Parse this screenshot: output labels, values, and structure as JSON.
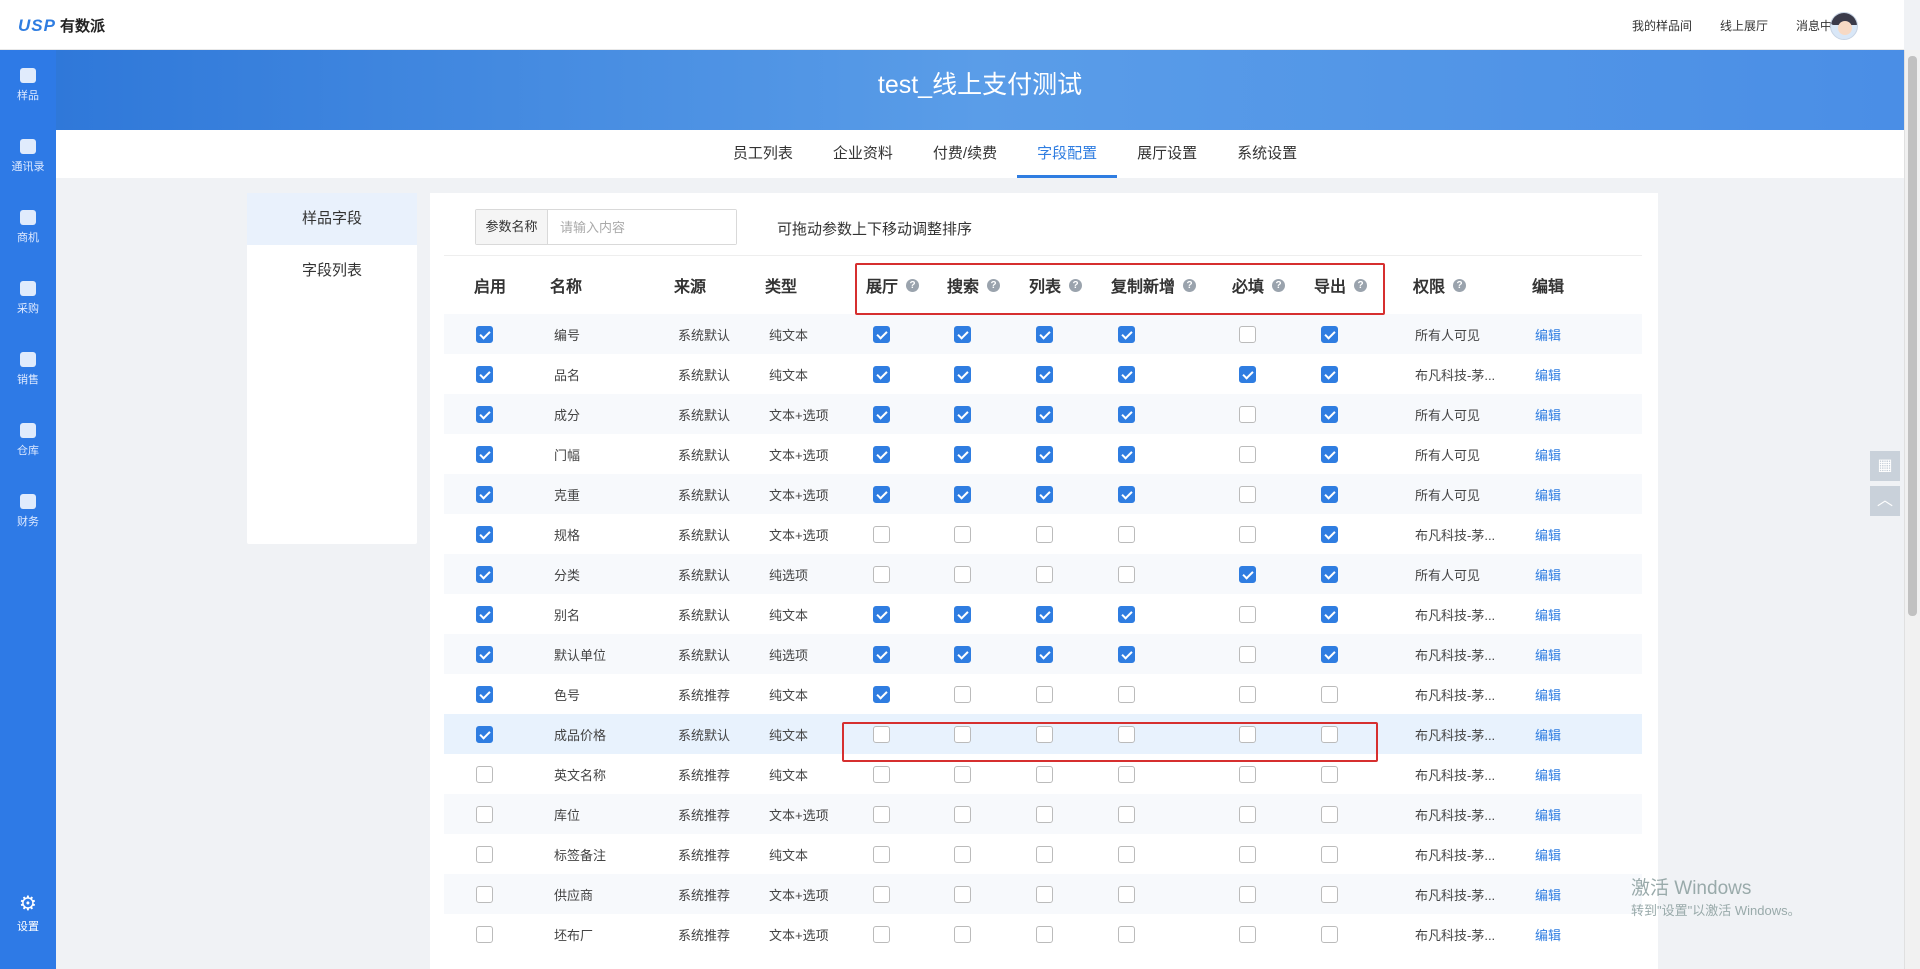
{
  "app": {
    "logo_mark": "USP",
    "logo_name": "有数派"
  },
  "topnav": [
    "我的样品间",
    "线上展厅",
    "消息中心"
  ],
  "sidebar": [
    {
      "label": "样品",
      "icon": "sample-icon"
    },
    {
      "label": "通讯录",
      "icon": "contacts-icon"
    },
    {
      "label": "商机",
      "icon": "opportunity-icon"
    },
    {
      "label": "采购",
      "icon": "purchase-icon"
    },
    {
      "label": "销售",
      "icon": "sales-icon"
    },
    {
      "label": "仓库",
      "icon": "warehouse-icon"
    },
    {
      "label": "财务",
      "icon": "finance-icon"
    }
  ],
  "sidebar_settings": {
    "label": "设置",
    "icon": "gear-icon"
  },
  "banner": {
    "title": "test_线上支付测试"
  },
  "tabs": [
    "员工列表",
    "企业资料",
    "付费/续费",
    "字段配置",
    "展厅设置",
    "系统设置"
  ],
  "active_tab": "字段配置",
  "leftmenu": [
    "样品字段",
    "字段列表"
  ],
  "search": {
    "label": "参数名称",
    "placeholder": "请输入内容"
  },
  "hint": "可拖动参数上下移动调整排序",
  "headers": [
    "启用",
    "名称",
    "来源",
    "类型",
    "展厅",
    "搜索",
    "列表",
    "复制新增",
    "必填",
    "导出",
    "权限",
    "编辑"
  ],
  "rows": [
    {
      "enabled": true,
      "name": "编号",
      "source": "系统默认",
      "type": "纯文本",
      "flags": [
        1,
        1,
        1,
        1,
        0,
        1
      ],
      "perm": "所有人可见",
      "edit": "编辑"
    },
    {
      "enabled": true,
      "name": "品名",
      "source": "系统默认",
      "type": "纯文本",
      "flags": [
        1,
        1,
        1,
        1,
        1,
        1
      ],
      "perm": "布凡科技-茅...",
      "edit": "编辑"
    },
    {
      "enabled": true,
      "name": "成分",
      "source": "系统默认",
      "type": "文本+选项",
      "flags": [
        1,
        1,
        1,
        1,
        0,
        1
      ],
      "perm": "所有人可见",
      "edit": "编辑"
    },
    {
      "enabled": true,
      "name": "门幅",
      "source": "系统默认",
      "type": "文本+选项",
      "flags": [
        1,
        1,
        1,
        1,
        0,
        1
      ],
      "perm": "所有人可见",
      "edit": "编辑"
    },
    {
      "enabled": true,
      "name": "克重",
      "source": "系统默认",
      "type": "文本+选项",
      "flags": [
        1,
        1,
        1,
        1,
        0,
        1
      ],
      "perm": "所有人可见",
      "edit": "编辑"
    },
    {
      "enabled": true,
      "name": "规格",
      "source": "系统默认",
      "type": "文本+选项",
      "flags": [
        0,
        0,
        0,
        0,
        0,
        1
      ],
      "perm": "布凡科技-茅...",
      "edit": "编辑"
    },
    {
      "enabled": true,
      "name": "分类",
      "source": "系统默认",
      "type": "纯选项",
      "flags": [
        0,
        0,
        0,
        0,
        1,
        1
      ],
      "perm": "所有人可见",
      "edit": "编辑"
    },
    {
      "enabled": true,
      "name": "别名",
      "source": "系统默认",
      "type": "纯文本",
      "flags": [
        1,
        1,
        1,
        1,
        0,
        1
      ],
      "perm": "布凡科技-茅...",
      "edit": "编辑"
    },
    {
      "enabled": true,
      "name": "默认单位",
      "source": "系统默认",
      "type": "纯选项",
      "flags": [
        1,
        1,
        1,
        1,
        0,
        1
      ],
      "perm": "布凡科技-茅...",
      "edit": "编辑"
    },
    {
      "enabled": true,
      "name": "色号",
      "source": "系统推荐",
      "type": "纯文本",
      "flags": [
        1,
        0,
        0,
        0,
        0,
        0
      ],
      "perm": "布凡科技-茅...",
      "edit": "编辑"
    },
    {
      "enabled": true,
      "name": "成品价格",
      "source": "系统默认",
      "type": "纯文本",
      "flags": [
        0,
        0,
        0,
        0,
        0,
        0
      ],
      "perm": "布凡科技-茅...",
      "edit": "编辑"
    },
    {
      "enabled": false,
      "name": "英文名称",
      "source": "系统推荐",
      "type": "纯文本",
      "flags": [
        0,
        0,
        0,
        0,
        0,
        0
      ],
      "perm": "布凡科技-茅...",
      "edit": "编辑"
    },
    {
      "enabled": false,
      "name": "库位",
      "source": "系统推荐",
      "type": "文本+选项",
      "flags": [
        0,
        0,
        0,
        0,
        0,
        0
      ],
      "perm": "布凡科技-茅...",
      "edit": "编辑"
    },
    {
      "enabled": false,
      "name": "标签备注",
      "source": "系统推荐",
      "type": "纯文本",
      "flags": [
        0,
        0,
        0,
        0,
        0,
        0
      ],
      "perm": "布凡科技-茅...",
      "edit": "编辑"
    },
    {
      "enabled": false,
      "name": "供应商",
      "source": "系统推荐",
      "type": "文本+选项",
      "flags": [
        0,
        0,
        0,
        0,
        0,
        0
      ],
      "perm": "布凡科技-茅...",
      "edit": "编辑"
    },
    {
      "enabled": false,
      "name": "坯布厂",
      "source": "系统推荐",
      "type": "文本+选项",
      "flags": [
        0,
        0,
        0,
        0,
        0,
        0
      ],
      "perm": "布凡科技-茅...",
      "edit": "编辑"
    }
  ],
  "highlighted_row": "成品价格",
  "watermark": {
    "title": "激活 Windows",
    "sub": "转到\"设置\"以激活 Windows。"
  },
  "colors": {
    "primary": "#2f7de1",
    "sidebar": "#2e7ae6",
    "annotation": "#d62f2f"
  }
}
